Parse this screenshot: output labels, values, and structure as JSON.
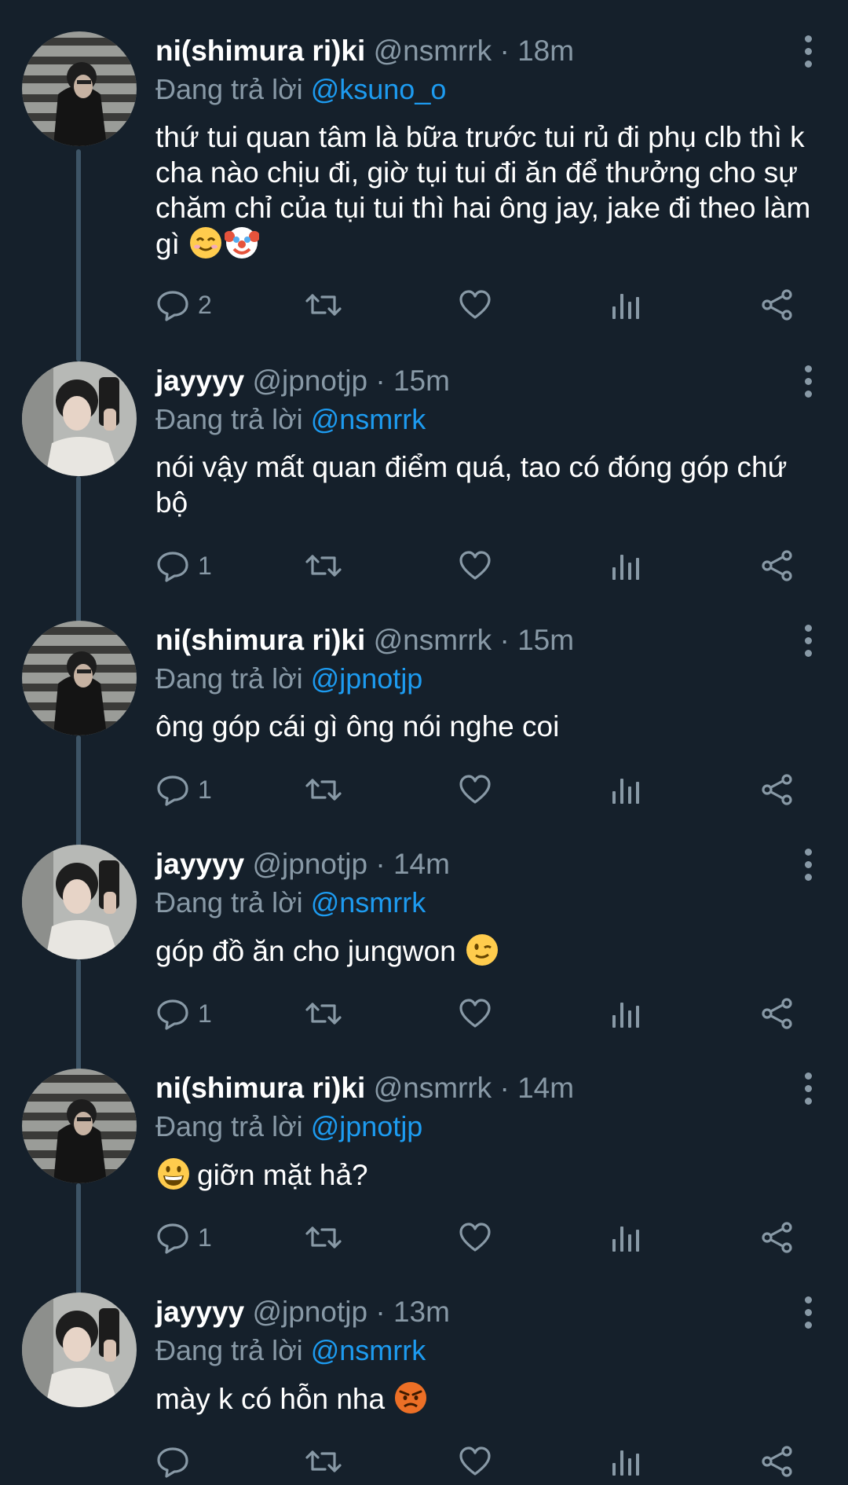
{
  "reply_prefix": "Đang trả lời",
  "tweets": [
    {
      "name": "ni(shimura ri)ki",
      "handle": "@nsmrrk",
      "dot": "·",
      "time": "18m",
      "reply_to": "@ksuno_o",
      "text": "thứ tui quan tâm là bữa trước tui rủ đi phụ clb thì k cha nào chịu đi, giờ tụi tui đi ăn để thưởng cho sự chăm chỉ của tụi tui thì hai ông jay, jake đi theo làm gì",
      "emojis": [
        "smiling-face-icon",
        "clown-face-icon"
      ],
      "reply_count": "2"
    },
    {
      "name": "jayyyy",
      "handle": "@jpnotjp",
      "dot": "·",
      "time": "15m",
      "reply_to": "@nsmrrk",
      "text": "nói vậy mất quan điểm quá, tao có đóng góp chứ bộ",
      "emojis": [],
      "reply_count": "1"
    },
    {
      "name": "ni(shimura ri)ki",
      "handle": "@nsmrrk",
      "dot": "·",
      "time": "15m",
      "reply_to": "@jpnotjp",
      "text": "ông góp cái gì ông nói nghe coi",
      "emojis": [],
      "reply_count": "1"
    },
    {
      "name": "jayyyy",
      "handle": "@jpnotjp",
      "dot": "·",
      "time": "14m",
      "reply_to": "@nsmrrk",
      "text": "góp đồ ăn cho jungwon",
      "emojis": [
        "winking-face-icon"
      ],
      "reply_count": "1"
    },
    {
      "name": "ni(shimura ri)ki",
      "handle": "@nsmrrk",
      "dot": "·",
      "time": "14m",
      "reply_to": "@jpnotjp",
      "text": "giỡn mặt hả?",
      "emojis": [
        "grinning-face-icon"
      ],
      "reply_count": "1"
    },
    {
      "name": "jayyyy",
      "handle": "@jpnotjp",
      "dot": "·",
      "time": "13m",
      "reply_to": "@nsmrrk",
      "text": "mày k có hỗn nha",
      "emojis": [
        "angry-face-icon"
      ],
      "reply_count": ""
    }
  ],
  "colors": {
    "background": "#15202b",
    "secondary_text": "#8899a6",
    "mention": "#1d9bf0",
    "thread_line": "#3d5466"
  }
}
